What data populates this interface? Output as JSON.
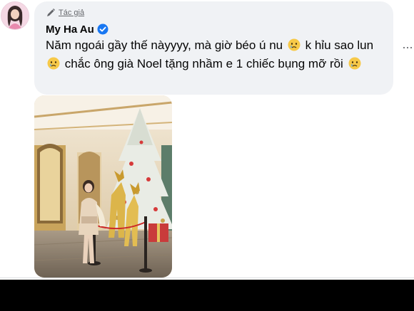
{
  "comment": {
    "badge_label": "Tác giả",
    "badge_icon": "pen-icon",
    "author": "My Ha Au",
    "verified_icon": "verified-badge-icon",
    "text_segments": [
      "Năm ngoái gầy thế nàyyyy, mà giờ béo ú nu",
      "k hỉu sao lun",
      "chắc ông già Noel tặng nhầm e 1 chiếc bụng mỡ rồi"
    ],
    "emoji_icon": "tearful-face-emoji-icon",
    "more_label": "...",
    "attachment_icon": "christmas-tree-photo"
  },
  "colors": {
    "bubble": "#f0f2f5",
    "text": "#050505",
    "secondary": "#65676b",
    "verified": "#1877f2"
  }
}
